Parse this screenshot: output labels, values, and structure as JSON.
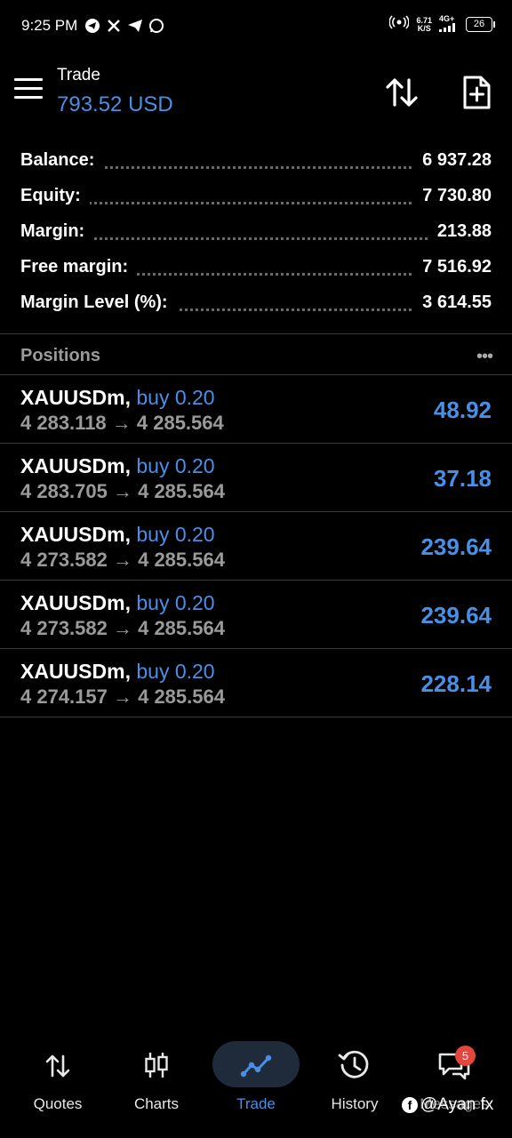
{
  "status_bar": {
    "time": "9:25 PM",
    "net_speed_value": "6.71",
    "net_speed_unit": "K/S",
    "network_gen": "4G+",
    "battery": "26"
  },
  "toolbar": {
    "title": "Trade",
    "subtitle": "793.52 USD"
  },
  "summary": [
    {
      "label": "Balance:",
      "value": "6 937.28"
    },
    {
      "label": "Equity:",
      "value": "7 730.80"
    },
    {
      "label": "Margin:",
      "value": "213.88"
    },
    {
      "label": "Free margin:",
      "value": "7 516.92"
    },
    {
      "label": "Margin Level (%):",
      "value": "3 614.55"
    }
  ],
  "positions": {
    "title": "Positions",
    "more_label": "•••",
    "items": [
      {
        "symbol": "XAUUSDm,",
        "side": "buy 0.20",
        "prices": "4 283.118 → 4 285.564",
        "profit": "48.92"
      },
      {
        "symbol": "XAUUSDm,",
        "side": "buy 0.20",
        "prices": "4 283.705 → 4 285.564",
        "profit": "37.18"
      },
      {
        "symbol": "XAUUSDm,",
        "side": "buy 0.20",
        "prices": "4 273.582 → 4 285.564",
        "profit": "239.64"
      },
      {
        "symbol": "XAUUSDm,",
        "side": "buy 0.20",
        "prices": "4 273.582 → 4 285.564",
        "profit": "239.64"
      },
      {
        "symbol": "XAUUSDm,",
        "side": "buy 0.20",
        "prices": "4 274.157 → 4 285.564",
        "profit": "228.14"
      }
    ]
  },
  "bottom_nav": {
    "items": [
      {
        "label": "Quotes",
        "icon": "quotes-icon"
      },
      {
        "label": "Charts",
        "icon": "charts-icon"
      },
      {
        "label": "Trade",
        "icon": "trade-icon"
      },
      {
        "label": "History",
        "icon": "history-icon"
      },
      {
        "label": "Messages",
        "icon": "messages-icon"
      }
    ],
    "messages_badge": "5"
  },
  "watermark": "@Ayan fx",
  "colors": {
    "accent": "#4a8fe6",
    "background": "#000000",
    "muted": "#9a9a9a",
    "badge": "#e2463d"
  }
}
